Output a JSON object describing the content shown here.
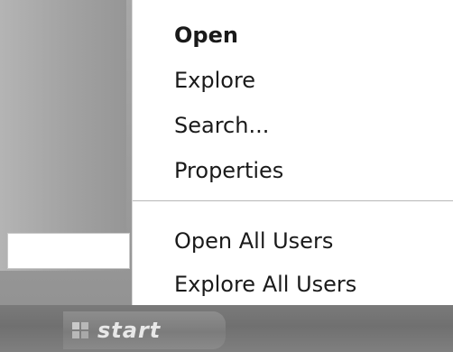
{
  "taskbar": {
    "start_label": "start"
  },
  "context_menu": {
    "items": [
      {
        "label": "Open",
        "bold": true
      },
      {
        "label": "Explore",
        "bold": false
      },
      {
        "label": "Search...",
        "bold": false
      },
      {
        "label": "Properties",
        "bold": false
      },
      {
        "label": "Open All Users",
        "bold": false
      },
      {
        "label": "Explore All Users",
        "bold": false
      }
    ]
  }
}
